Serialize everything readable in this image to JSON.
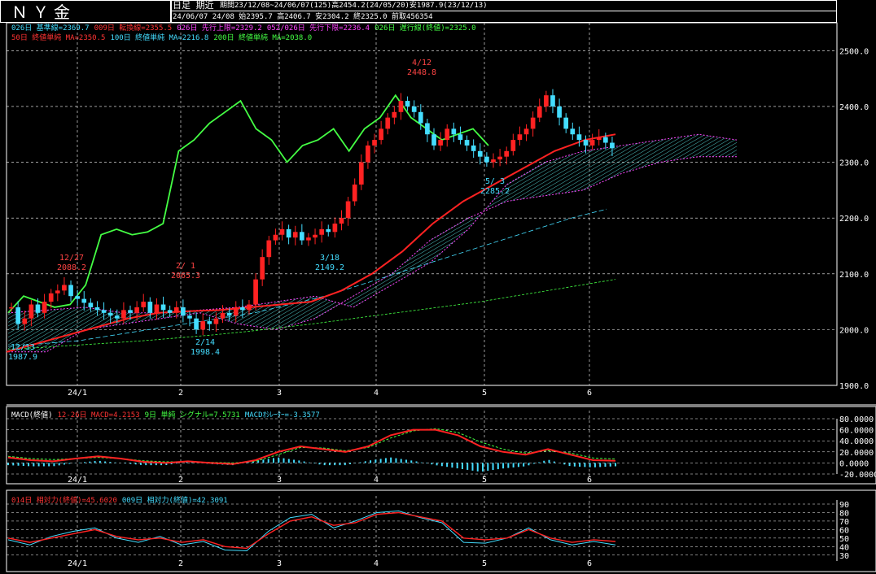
{
  "header": {
    "title": "ＮＹ金",
    "line1_a": "日足 期近",
    "line1_b": "期間23/12/08~24/06/07(125)高2454.2(24/05/20)安1987.9(23/12/13)",
    "line2": "24/06/07 24/08 始2395.7 高2406.7 安2304.2 終2325.0 前取456354"
  },
  "legend": {
    "row1": [
      {
        "text": "026日 基準線=2369.7",
        "color": "#44ddff"
      },
      {
        "text": "009日 転換線=2355.5",
        "color": "#ff3333"
      },
      {
        "text": "026日 先行上限=2329.2",
        "color": "#ff44ff"
      },
      {
        "text": "052/026日 先行下限=2236.4",
        "color": "#ff44ff"
      },
      {
        "text": "026日 遅行線(終値)=2325.0",
        "color": "#44ff44"
      }
    ],
    "row2": [
      {
        "text": "50日 終値単純 MA=2350.5",
        "color": "#ff3333"
      },
      {
        "text": "100日 終値単純 MA=2216.8",
        "color": "#44ddff"
      },
      {
        "text": "200日 終値単純 MA=2038.0",
        "color": "#44ff44"
      }
    ]
  },
  "annotations": [
    {
      "text": "12/27",
      "sub": "2088.2",
      "color": "#ff4444"
    },
    {
      "text": "2/ 1",
      "sub": "2065.3",
      "color": "#ff4444"
    },
    {
      "text": "4/12",
      "sub": "2448.8",
      "color": "#ff4444"
    },
    {
      "text": "12/13",
      "sub": "1987.9",
      "color": "#44ddff"
    },
    {
      "text": "2/14",
      "sub": "1998.4",
      "color": "#44ddff"
    },
    {
      "text": "3/18",
      "sub": "2149.2",
      "color": "#44ddff"
    },
    {
      "text": "5/ 3",
      "sub": "2285.2",
      "color": "#44ddff"
    }
  ],
  "macd_legend": [
    {
      "text": "MACD(終値)",
      "color": "#ffffff"
    },
    {
      "text": "12-26日 MACD=4.2153",
      "color": "#ff3333"
    },
    {
      "text": "9日 単純 シグナル=7.5731",
      "color": "#44ff44"
    },
    {
      "text": "MACDｵｼﾚｰﾀｰ=-3.3577",
      "color": "#44ddff"
    }
  ],
  "rsi_legend": [
    {
      "text": "014日 相対力(終値)=45.6020",
      "color": "#ff3333"
    },
    {
      "text": "009日 相対力(終値)=42.3091",
      "color": "#44ddff"
    }
  ],
  "chart_data": [
    {
      "type": "candlestick",
      "title": "ＮＹ金",
      "x_tick_labels": [
        "24/1",
        "2",
        "3",
        "4",
        "5",
        "6"
      ],
      "ylim": [
        1900,
        2550
      ],
      "y_ticks": [
        1900,
        2000,
        2100,
        2200,
        2300,
        2400,
        2500
      ],
      "y_tick_labels": [
        "1900.0",
        "2000.0",
        "2100.0",
        "2200.0",
        "2300.0",
        "2400.0",
        "2500.0"
      ],
      "grid": true,
      "close_path": [
        2040,
        2010,
        2020,
        2045,
        2030,
        2050,
        2065,
        2070,
        2080,
        2060,
        2055,
        2048,
        2040,
        2035,
        2030,
        2025,
        2020,
        2035,
        2030,
        2040,
        2050,
        2030,
        2045,
        2035,
        2030,
        2040,
        2025,
        2020,
        2000,
        2015,
        2010,
        2020,
        2030,
        2025,
        2040,
        2035,
        2045,
        2090,
        2130,
        2160,
        2170,
        2180,
        2165,
        2175,
        2160,
        2165,
        2170,
        2180,
        2175,
        2190,
        2200,
        2230,
        2260,
        2300,
        2330,
        2340,
        2360,
        2380,
        2390,
        2410,
        2400,
        2390,
        2370,
        2350,
        2330,
        2340,
        2360,
        2350,
        2340,
        2330,
        2320,
        2310,
        2300,
        2305,
        2310,
        2320,
        2340,
        2350,
        2360,
        2380,
        2400,
        2420,
        2400,
        2380,
        2360,
        2350,
        2340,
        2330,
        2340,
        2345,
        2335,
        2325
      ],
      "series": [
        {
          "name": "50日 終値単純 MA",
          "color": "#ff2222",
          "values": [
            1960,
            1975,
            1990,
            2005,
            2020,
            2030,
            2033,
            2035,
            2040,
            2045,
            2050,
            2070,
            2100,
            2140,
            2190,
            2230,
            2260,
            2290,
            2320,
            2340,
            2350
          ]
        },
        {
          "name": "100日 終値単純 MA",
          "color": "#44ddff",
          "values": [
            1970,
            1975,
            1980,
            1990,
            2000,
            2010,
            2020,
            2030,
            2045,
            2060,
            2080,
            2100,
            2120,
            2140,
            2160,
            2180,
            2200,
            2216
          ]
        },
        {
          "name": "200日 終値単純 MA",
          "color": "#44ff44",
          "values": [
            1965,
            1968,
            1972,
            1976,
            1980,
            1985,
            1990,
            1996,
            2003,
            2010,
            2018,
            2026,
            2034,
            2042,
            2050,
            2060,
            2070,
            2080,
            2090
          ]
        },
        {
          "name": "026日 遅行線(終値)",
          "color": "#44ff44",
          "values": [
            2030,
            2060,
            2050,
            2040,
            2045,
            2080,
            2170,
            2180,
            2170,
            2175,
            2190,
            2320,
            2340,
            2370,
            2390,
            2410,
            2360,
            2340,
            2300,
            2330,
            2340,
            2360,
            2320,
            2360,
            2380,
            2420,
            2380,
            2360,
            2340,
            2350,
            2360,
            2330
          ]
        },
        {
          "name": "026日 先行上限",
          "color": "#ff44ff",
          "values": [
            2030,
            2035,
            2040,
            2030,
            2030,
            2035,
            2040,
            2050,
            2060,
            2040,
            2080,
            2120,
            2180,
            2260,
            2300,
            2320,
            2330,
            2340,
            2350,
            2340
          ]
        },
        {
          "name": "052/026日 先行下限",
          "color": "#ff44ff",
          "values": [
            1960,
            1960,
            2000,
            2010,
            2020,
            2030,
            2010,
            2000,
            2020,
            2060,
            2100,
            2160,
            2200,
            2230,
            2240,
            2250,
            2280,
            2300,
            2310,
            2310
          ]
        }
      ]
    },
    {
      "type": "line",
      "title": "MACD(終値)",
      "ylim": [
        -20,
        80
      ],
      "y_tick_labels": [
        "80.0000",
        "60.0000",
        "40.0000",
        "20.0000",
        "0.0000",
        "-20.0000"
      ],
      "series": [
        {
          "name": "12-26日 MACD",
          "color": "#ff2222",
          "values": [
            10,
            5,
            3,
            8,
            12,
            8,
            2,
            0,
            3,
            0,
            -2,
            5,
            20,
            30,
            25,
            20,
            30,
            50,
            60,
            60,
            50,
            30,
            20,
            15,
            25,
            15,
            5,
            4
          ]
        },
        {
          "name": "9日 単純 シグナル",
          "color": "#44ff44",
          "values": [
            12,
            8,
            6,
            8,
            10,
            8,
            4,
            2,
            2,
            1,
            0,
            3,
            15,
            28,
            27,
            22,
            28,
            45,
            58,
            62,
            55,
            38,
            25,
            18,
            22,
            18,
            9,
            7
          ]
        }
      ]
    },
    {
      "type": "line",
      "title": "相対力",
      "ylim": [
        25,
        90
      ],
      "y_tick_labels": [
        "90",
        "80",
        "70",
        "60",
        "50",
        "40",
        "30"
      ],
      "series": [
        {
          "name": "014日 相対力(終値)",
          "color": "#ff2222",
          "values": [
            50,
            45,
            50,
            55,
            60,
            52,
            48,
            50,
            45,
            48,
            40,
            38,
            55,
            70,
            75,
            65,
            68,
            78,
            80,
            75,
            70,
            50,
            48,
            50,
            60,
            50,
            45,
            48,
            46
          ]
        },
        {
          "name": "009日 相対力(終値)",
          "color": "#44ddff",
          "values": [
            48,
            42,
            52,
            58,
            62,
            50,
            45,
            52,
            42,
            46,
            36,
            35,
            58,
            74,
            78,
            62,
            70,
            80,
            82,
            74,
            68,
            45,
            44,
            50,
            62,
            48,
            42,
            46,
            42
          ]
        }
      ]
    }
  ]
}
